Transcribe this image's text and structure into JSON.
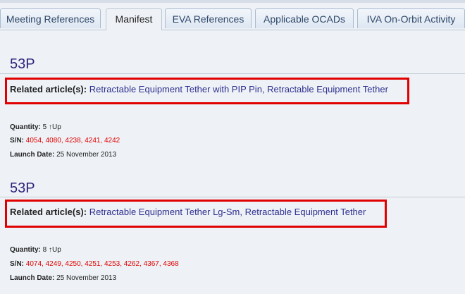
{
  "tabs": [
    {
      "label": "Meeting References",
      "active": false
    },
    {
      "label": "Manifest",
      "active": true
    },
    {
      "label": "EVA References",
      "active": false
    },
    {
      "label": "Applicable OCADs",
      "active": false
    },
    {
      "label": "IVA On-Orbit Activity",
      "active": false
    }
  ],
  "sections": [
    {
      "title": "53P",
      "related_label": "Related article(s):",
      "related_value": "Retractable Equipment Tether with PIP Pin, Retractable Equipment Tether",
      "quantity_label": "Quantity:",
      "quantity_value": "5 ↑Up",
      "sn_label": "S/N:",
      "sn_value": "4054, 4080, 4238, 4241, 4242",
      "launch_label": "Launch Date:",
      "launch_value": "25 November 2013"
    },
    {
      "title": "53P",
      "related_label": "Related article(s):",
      "related_value": "Retractable Equipment Tether Lg-Sm, Retractable Equipment Tether",
      "quantity_label": "Quantity:",
      "quantity_value": "8 ↑Up",
      "sn_label": "S/N:",
      "sn_value": "4074, 4249, 4250, 4251, 4253, 4262, 4367, 4368",
      "launch_label": "Launch Date:",
      "launch_value": "25 November 2013"
    }
  ],
  "colors": {
    "highlight_box": "#e00000",
    "title": "#2b1f7a",
    "link": "#2f2f8f",
    "serial": "#e00000"
  }
}
